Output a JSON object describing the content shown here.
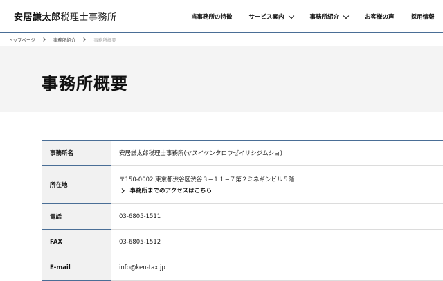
{
  "header": {
    "logo_name": "安居謙太郎",
    "logo_suffix": "税理士事務所",
    "nav": [
      {
        "label": "当事務所の特徴",
        "dropdown": false
      },
      {
        "label": "サービス案内",
        "dropdown": true
      },
      {
        "label": "事務所紹介",
        "dropdown": true
      },
      {
        "label": "お客様の声",
        "dropdown": false
      },
      {
        "label": "採用情報",
        "dropdown": false
      }
    ]
  },
  "breadcrumb": {
    "items": [
      "トップページ",
      "事務所紹介",
      "事務所概要"
    ]
  },
  "page": {
    "title": "事務所概要"
  },
  "office": {
    "rows": [
      {
        "label": "事務所名",
        "value": "安居謙太郎税理士事務所(ヤスイケンタロウゼイリシジムショ)"
      },
      {
        "label": "所在地",
        "value": "〒150-0002 東京都渋谷区渋谷３−１１−７第２ミネギシビル５階",
        "link": "事務所までのアクセスはこちら"
      },
      {
        "label": "電話",
        "value": "03-6805-1511"
      },
      {
        "label": "FAX",
        "value": "03-6805-1512"
      },
      {
        "label": "E-mail",
        "value": "info@ken-tax.jp"
      }
    ]
  }
}
